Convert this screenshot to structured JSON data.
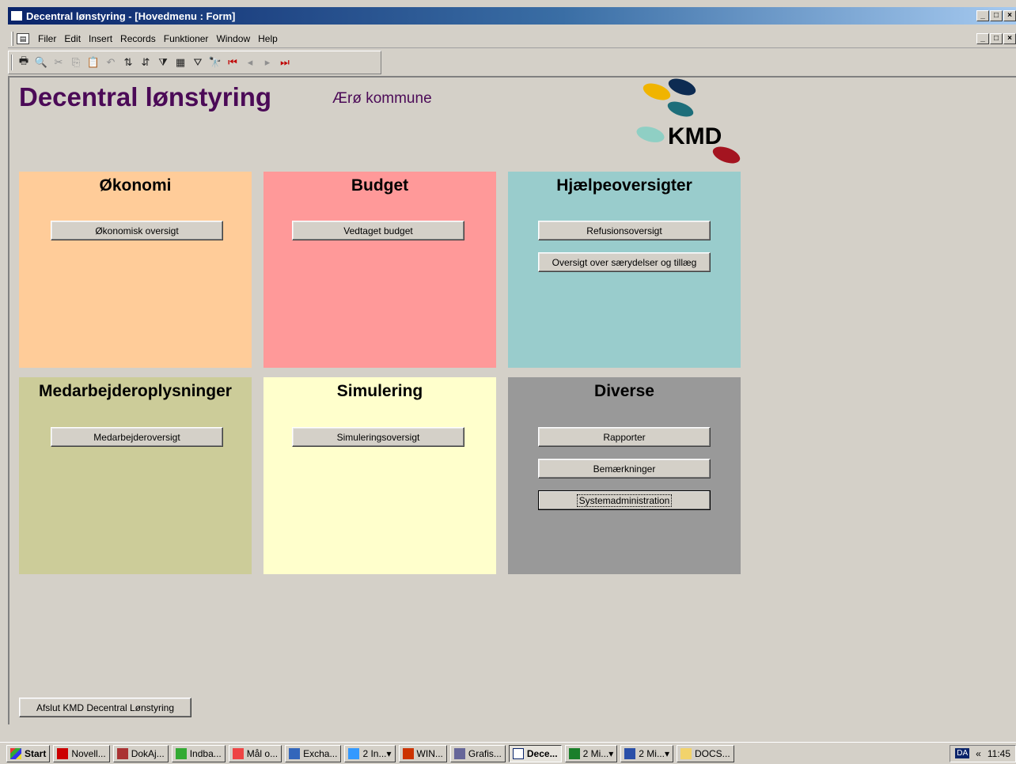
{
  "window": {
    "title": "Decentral lønstyring - [Hovedmenu : Form]",
    "controls": [
      "_",
      "□",
      "×"
    ]
  },
  "menubar": {
    "items": [
      "Filer",
      "Edit",
      "Insert",
      "Records",
      "Funktioner",
      "Window",
      "Help"
    ],
    "doc_controls": [
      "_",
      "□",
      "×"
    ]
  },
  "toolbar": {
    "icons": [
      "print-icon",
      "print-preview-icon",
      "cut-icon",
      "copy-icon",
      "paste-icon",
      "undo-icon",
      "sort-ascending-icon",
      "sort-descending-icon",
      "filter-by-selection-icon",
      "filter-by-form-icon",
      "apply-filter-icon",
      "find-icon",
      "first-record-icon",
      "previous-record-icon",
      "next-record-icon",
      "last-record-icon"
    ]
  },
  "header": {
    "title": "Decentral lønstyring",
    "subtitle": "Ærø kommune",
    "logo_text": "KMD"
  },
  "panels": {
    "okonomi": {
      "title": "Økonomi",
      "color": "#ffcc99",
      "buttons": [
        "Økonomisk oversigt"
      ]
    },
    "budget": {
      "title": "Budget",
      "color": "#ff9999",
      "buttons": [
        "Vedtaget budget"
      ]
    },
    "hjaelp": {
      "title": "Hjælpeoversigter",
      "color": "#99cccc",
      "buttons": [
        "Refusionsoversigt",
        "Oversigt over særydelser og tillæg"
      ]
    },
    "medarb": {
      "title": "Medarbejderoplysninger",
      "color": "#cccc99",
      "buttons": [
        "Medarbejderoversigt"
      ]
    },
    "simulering": {
      "title": "Simulering",
      "color": "#ffffcc",
      "buttons": [
        "Simuleringsoversigt"
      ]
    },
    "diverse": {
      "title": "Diverse",
      "color": "#999999",
      "buttons": [
        "Rapporter",
        "Bemærkninger",
        "Systemadministration"
      ]
    }
  },
  "exit_button": "Afslut KMD Decentral Lønstyring",
  "taskbar": {
    "start": "Start",
    "tasks": [
      "Novell...",
      "DokAj...",
      "Indba...",
      "Mål o...",
      "Excha...",
      "2 In...",
      "WIN...",
      "Grafis...",
      "Dece...",
      "2 Mi...",
      "2 Mi...",
      "DOCS..."
    ],
    "language": "DA",
    "clock": "11:45"
  }
}
